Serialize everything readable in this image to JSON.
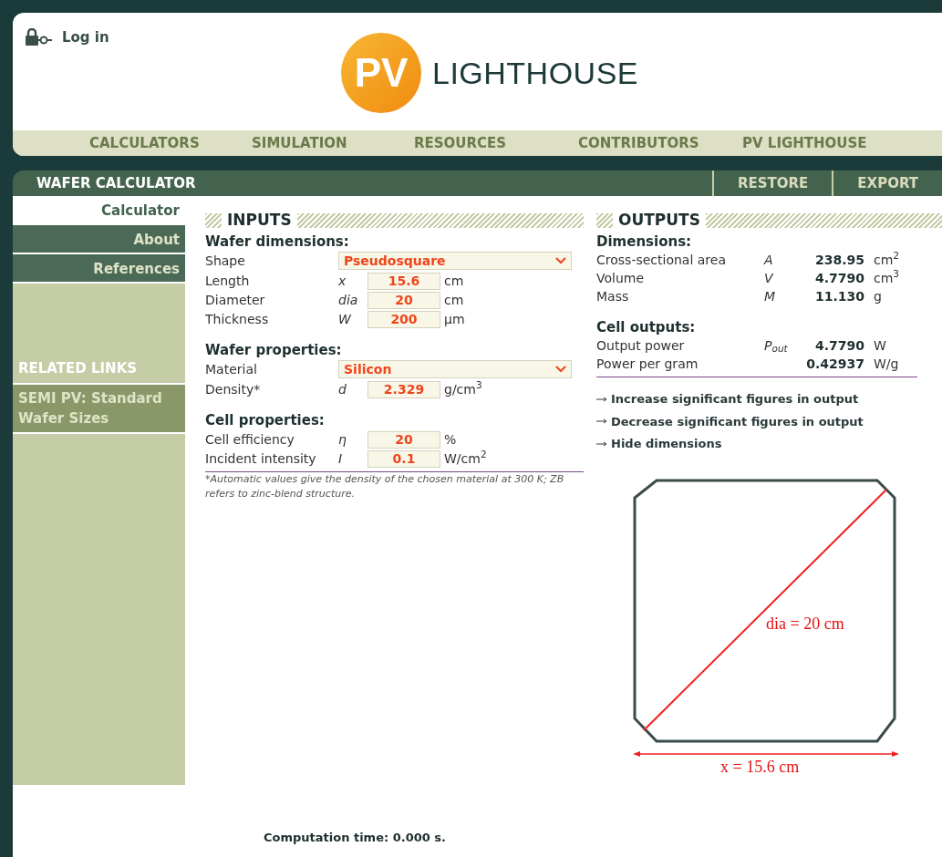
{
  "header": {
    "login": "Log in",
    "logo_mark": "PV",
    "logo_text": "LIGHTHOUSE"
  },
  "nav": [
    "CALCULATORS",
    "SIMULATION",
    "RESOURCES",
    "CONTRIBUTORS",
    "PV LIGHTHOUSE"
  ],
  "toolbar": {
    "title": "WAFER CALCULATOR",
    "buttons": [
      "RESTORE",
      "EXPORT"
    ]
  },
  "sidebar": {
    "tabs": [
      {
        "label": "Calculator",
        "selected": true
      },
      {
        "label": "About",
        "selected": false
      },
      {
        "label": "References",
        "selected": false
      }
    ],
    "related_heading": "RELATED LINKS",
    "links": [
      "SEMI PV: Standard Wafer Sizes"
    ]
  },
  "inputs": {
    "title": "INPUTS",
    "sections": [
      {
        "heading": "Wafer dimensions:",
        "rows": [
          {
            "kind": "select",
            "label": "Shape",
            "value": "Pseudosquare"
          },
          {
            "kind": "number",
            "label": "Length",
            "symbol": "x",
            "value": "15.6",
            "unit": "cm"
          },
          {
            "kind": "number",
            "label": "Diameter",
            "symbol": "dia",
            "value": "20",
            "unit": "cm"
          },
          {
            "kind": "number",
            "label": "Thickness",
            "symbol": "W",
            "value": "200",
            "unit": "µm"
          }
        ]
      },
      {
        "heading": "Wafer properties:",
        "rows": [
          {
            "kind": "select",
            "label": "Material",
            "value": "Silicon"
          },
          {
            "kind": "number",
            "label": "Density*",
            "symbol": "d",
            "value": "2.329",
            "unit": "g/cm$^{3}$"
          }
        ]
      },
      {
        "heading": "Cell properties:",
        "rows": [
          {
            "kind": "number",
            "label": "Cell efficiency",
            "symbol": "η",
            "value": "20",
            "unit": "%"
          },
          {
            "kind": "number",
            "label": "Incident intensity",
            "symbol": "I",
            "value": "0.1",
            "unit": "W/cm$^{2}$"
          }
        ]
      }
    ],
    "footnote": "*Automatic values give the density of the chosen material at 300 K; ZB refers to zinc-blend structure."
  },
  "outputs": {
    "title": "OUTPUTS",
    "sections": [
      {
        "heading": "Dimensions:",
        "rows": [
          {
            "label": "Cross-sectional area",
            "symbol": "A",
            "value": "238.95",
            "unit": "cm$^{2}$"
          },
          {
            "label": "Volume",
            "symbol": "V",
            "value": "4.7790",
            "unit": "cm$^{3}$"
          },
          {
            "label": "Mass",
            "symbol": "M",
            "value": "11.130",
            "unit": "g"
          }
        ]
      },
      {
        "heading": "Cell outputs:",
        "rows": [
          {
            "label": "Output power",
            "symbol": "P$_{out}$",
            "value": "4.7790",
            "unit": "W"
          },
          {
            "label": "Power per gram",
            "value": "0.42937",
            "unit": "W/g"
          }
        ]
      }
    ],
    "links": [
      "Increase significant figures in output",
      "Decrease significant figures in output",
      "Hide dimensions"
    ]
  },
  "diagram": {
    "dia_label": "dia = 20 cm",
    "x_label": "x = 15.6 cm"
  },
  "footer": "Computation time: 0.000 s."
}
